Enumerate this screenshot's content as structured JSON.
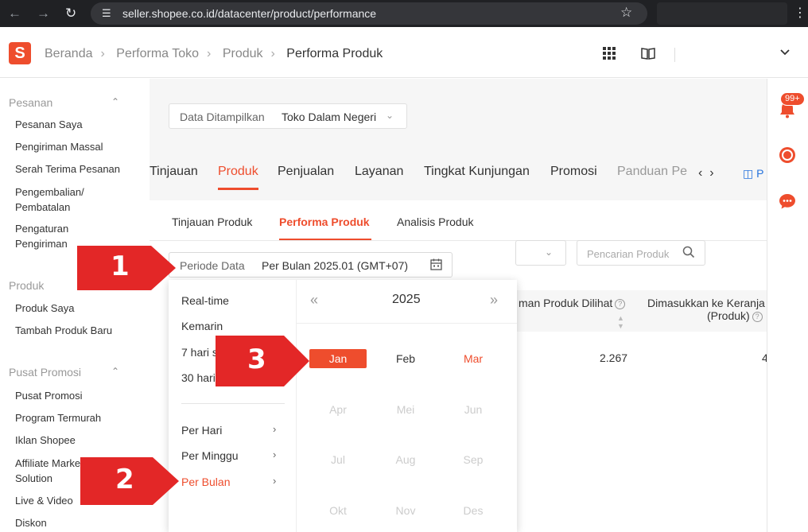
{
  "browser": {
    "url": "seller.shopee.co.id/datacenter/product/performance"
  },
  "header": {
    "logo_letter": "S",
    "breadcrumbs": [
      "Beranda",
      "Performa Toko",
      "Produk"
    ],
    "breadcrumb_current": "Performa Produk"
  },
  "sidebar": {
    "sections": [
      {
        "title": "Pesanan",
        "items": [
          "Pesanan Saya",
          "Pengiriman Massal",
          "Serah Terima Pesanan",
          "Pengembalian/ Pembatalan",
          "Pengaturan Pengiriman"
        ]
      },
      {
        "title": "Produk",
        "items": [
          "Produk Saya",
          "Tambah Produk Baru"
        ]
      },
      {
        "title": "Pusat Promosi",
        "items": [
          "Pusat Promosi",
          "Program Termurah",
          "Iklan Shopee",
          "Affiliate Marketing Solution",
          "Live & Video",
          "Diskon"
        ]
      }
    ]
  },
  "data_selector": {
    "label": "Data Ditampilkan",
    "value": "Toko Dalam Negeri"
  },
  "main_tabs": [
    "Tinjauan",
    "Produk",
    "Penjualan",
    "Layanan",
    "Tingkat Kunjungan",
    "Promosi",
    "Panduan Pe"
  ],
  "main_tab_active": "Produk",
  "main_tab_link": "P",
  "sub_tabs": [
    "Tinjauan Produk",
    "Performa Produk",
    "Analisis Produk"
  ],
  "sub_tab_active": "Performa Produk",
  "periode": {
    "label": "Periode Data",
    "value": "Per Bulan  2025.01 (GMT+07)"
  },
  "search": {
    "placeholder": "Pencarian Produk"
  },
  "table": {
    "headers": [
      "man Produk Dilihat",
      "Dimasukkan ke Keranja",
      "(Produk)"
    ],
    "row": [
      "2.267",
      "4"
    ]
  },
  "notifications": {
    "badge": "99+"
  },
  "date_popup": {
    "quick_options": [
      "Real-time",
      "Kemarin",
      "7 hari s",
      "30 hari"
    ],
    "granularity_options": [
      "Per Hari",
      "Per Minggu",
      "Per Bulan"
    ],
    "active_option": "Per Bulan",
    "year": "2025",
    "months": [
      "Jan",
      "Feb",
      "Mar",
      "Apr",
      "Mei",
      "Jun",
      "Jul",
      "Aug",
      "Sep",
      "Okt",
      "Nov",
      "Des"
    ],
    "selected_month": "Jan",
    "enabled_months": [
      "Jan",
      "Feb",
      "Mar"
    ],
    "current_month": "Mar"
  },
  "callouts": [
    "1",
    "2",
    "3"
  ],
  "colors": {
    "brand": "#ee4d2d",
    "callout": "#e32727",
    "link": "#2673dd"
  }
}
